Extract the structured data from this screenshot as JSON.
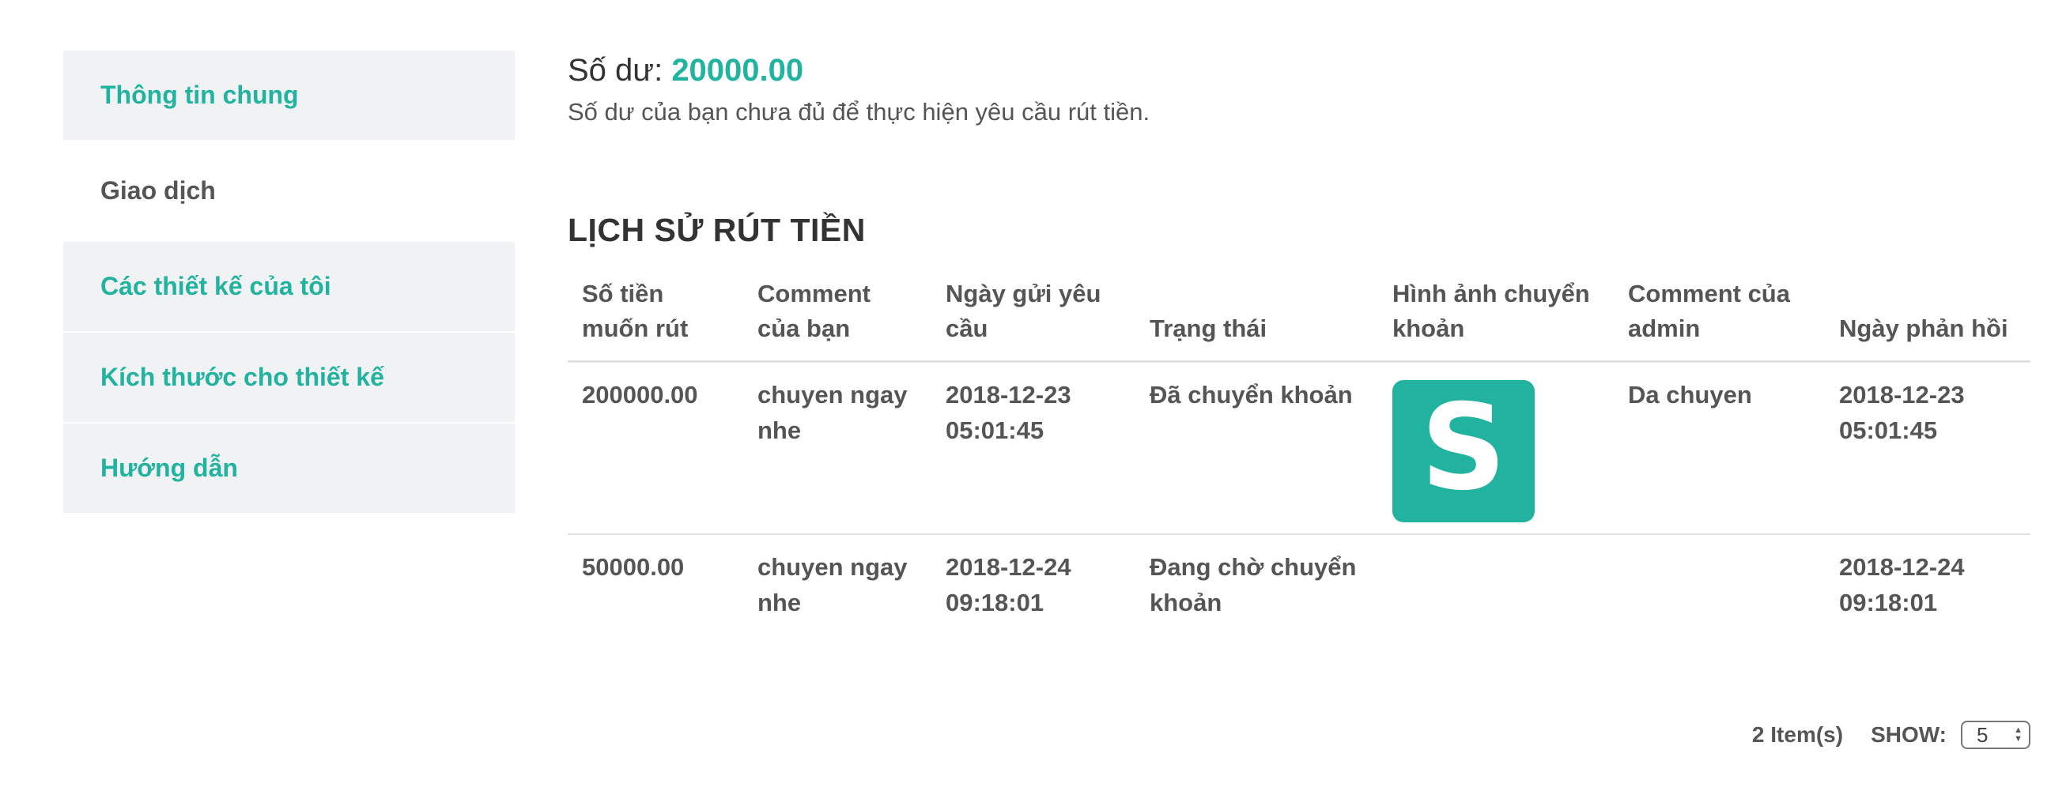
{
  "sidebar": {
    "items": [
      {
        "label": "Thông tin chung"
      },
      {
        "label": "Giao dịch"
      },
      {
        "label": "Các thiết kế của tôi"
      },
      {
        "label": "Kích thước cho thiết kế"
      },
      {
        "label": "Hướng dẫn"
      }
    ],
    "active_index": 1
  },
  "balance": {
    "label": "Số dư:",
    "value": "20000.00",
    "note": "Số dư của bạn chưa đủ để thực hiện yêu cầu rút tiền."
  },
  "history": {
    "title": "LỊCH SỬ RÚT TIỀN",
    "columns": [
      "Số tiền muốn rút",
      "Comment của bạn",
      "Ngày gửi yêu cầu",
      "Trạng thái",
      "Hình ảnh chuyển khoản",
      "Comment của admin",
      "Ngày phản hồi"
    ],
    "rows": [
      {
        "amount": "200000.00",
        "comment": "chuyen ngay nhe",
        "request_date": "2018-12-23 05:01:45",
        "status": "Đã chuyển khoản",
        "image_icon": "skype-logo",
        "admin_comment": "Da chuyen",
        "response_date": "2018-12-23 05:01:45"
      },
      {
        "amount": "50000.00",
        "comment": "chuyen ngay nhe",
        "request_date": "2018-12-24 09:18:01",
        "status": "Đang chờ chuyển khoản",
        "image_icon": "",
        "admin_comment": "",
        "response_date": "2018-12-24 09:18:01"
      }
    ]
  },
  "pager": {
    "items_count": "2 Item(s)",
    "show_label": "SHOW:",
    "show_value": "5"
  },
  "colors": {
    "accent": "#22b3a0",
    "sidebar_bg": "#f1f2f4",
    "text": "#555555"
  }
}
